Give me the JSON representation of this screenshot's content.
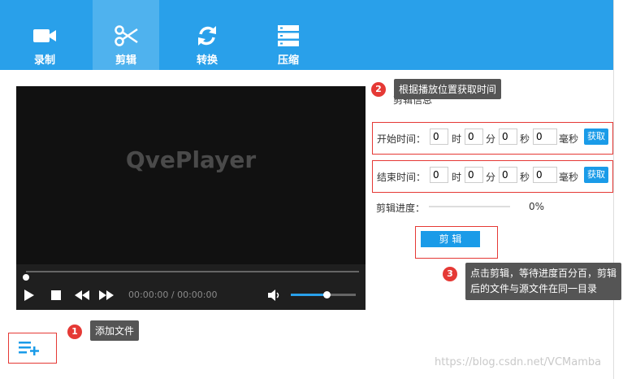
{
  "tabs": [
    {
      "label": "录制",
      "icon": "video-camera-icon"
    },
    {
      "label": "剪辑",
      "icon": "scissors-icon"
    },
    {
      "label": "转换",
      "icon": "refresh-icon"
    },
    {
      "label": "压缩",
      "icon": "server-icon"
    }
  ],
  "player": {
    "title": "QvePlayer",
    "time_display": "00:00:00 / 00:00:00",
    "seek_fraction": 0.0,
    "volume_fraction": 0.55
  },
  "clip": {
    "section_title": "剪辑信息",
    "start": {
      "label": "开始时间：",
      "hour": "0",
      "minute": "0",
      "second": "0",
      "millisecond": "0",
      "button": "获取"
    },
    "end": {
      "label": "结束时间：",
      "hour": "0",
      "minute": "0",
      "second": "0",
      "millisecond": "0",
      "button": "获取"
    },
    "units": {
      "hour": "时",
      "minute": "分",
      "second": "秒",
      "millisecond": "毫秒"
    },
    "progress_label": "剪辑进度：",
    "progress_percent": "0%",
    "cut_button": "剪 辑"
  },
  "tips": {
    "tip1": "添加文件",
    "tip2": "根据播放位置获取时间",
    "tip3_line1": "点击剪辑，等待进度百分百，剪辑",
    "tip3_line2": "后的文件与源文件在同一目录"
  },
  "markers": {
    "one": "1",
    "two": "2",
    "three": "3"
  },
  "watermark": "https://blog.csdn.net/VCMamba",
  "colors": {
    "accent": "#29a0ea",
    "button": "#1a9be8",
    "marker": "#e53935"
  }
}
